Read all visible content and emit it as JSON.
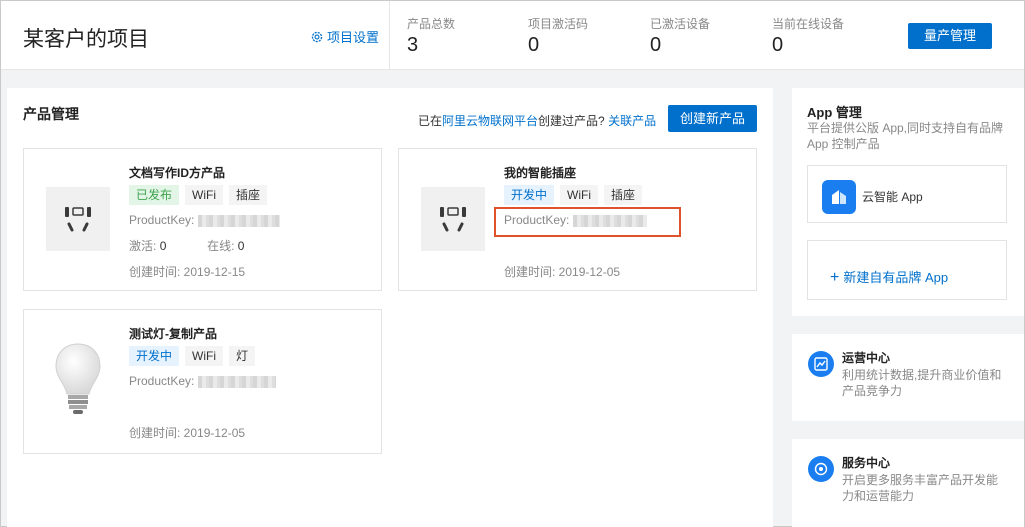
{
  "header": {
    "title": "某客户的项目",
    "settings_label": "项目设置",
    "stats": [
      {
        "label": "产品总数",
        "value": "3"
      },
      {
        "label": "项目激活码",
        "value": "0"
      },
      {
        "label": "已激活设备",
        "value": "0"
      },
      {
        "label": "当前在线设备",
        "value": "0"
      }
    ],
    "mass_button": "量产管理"
  },
  "products": {
    "title": "产品管理",
    "prompt_prefix": "已在",
    "platform_link": "阿里云物联网平台",
    "prompt_suffix": "创建过产品?",
    "relate_link": "关联产品",
    "create_button": "创建新产品",
    "cards": [
      {
        "name": "文档写作ID方产品",
        "tags": [
          "已发布",
          "WiFi",
          "插座"
        ],
        "productkey_label": "ProductKey:",
        "activate_label": "激活:",
        "activate_value": "0",
        "online_label": "在线:",
        "online_value": "0",
        "created": "创建时间: 2019-12-15",
        "icon": "socket-icon"
      },
      {
        "name": "我的智能插座",
        "tags": [
          "开发中",
          "WiFi",
          "插座"
        ],
        "productkey_label": "ProductKey:",
        "created": "创建时间: 2019-12-05",
        "icon": "socket-icon"
      },
      {
        "name": "测试灯-复制产品",
        "tags": [
          "开发中",
          "WiFi",
          "灯"
        ],
        "productkey_label": "ProductKey:",
        "created": "创建时间: 2019-12-05",
        "icon": "lightbulb-icon"
      }
    ]
  },
  "sidebar": {
    "app_title": "App 管理",
    "app_desc": "平台提供公版 App,同时支持自有品牌 App 控制产品",
    "app_name": "云智能 App",
    "new_brand": "新建自有品牌 App",
    "ops_title": "运营中心",
    "ops_desc": "利用统计数据,提升商业价值和产品竞争力",
    "svc_title": "服务中心",
    "svc_desc": "开启更多服务丰富产品开发能力和运营能力"
  },
  "colors": {
    "accent": "#0070cc",
    "published": "#3fa34d",
    "highlight": "#e0522a"
  }
}
